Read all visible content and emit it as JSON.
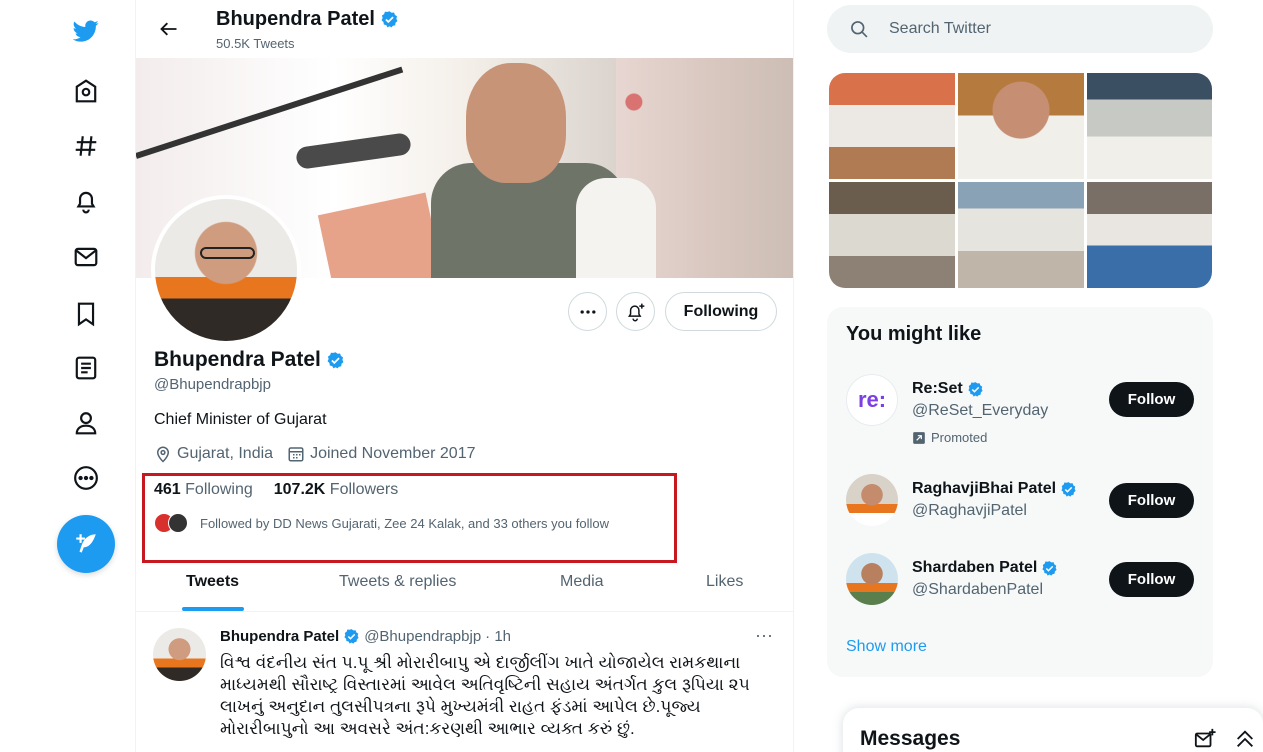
{
  "nav": {
    "items": [
      {
        "name": "twitter-logo-icon"
      },
      {
        "name": "home-icon"
      },
      {
        "name": "explore-hashtag-icon"
      },
      {
        "name": "notifications-bell-icon"
      },
      {
        "name": "messages-envelope-icon"
      },
      {
        "name": "bookmarks-icon"
      },
      {
        "name": "lists-icon"
      },
      {
        "name": "profile-icon"
      },
      {
        "name": "more-icon"
      }
    ],
    "brand_color": "#1d9bf0"
  },
  "header": {
    "name": "Bhupendra Patel",
    "tweet_count": "50.5K Tweets"
  },
  "profile": {
    "name": "Bhupendra Patel",
    "handle": "@Bhupendrapbjp",
    "bio": "Chief Minister of Gujarat",
    "location": "Gujarat, India",
    "joined": "Joined November 2017",
    "following_count": "461",
    "following_label": "Following",
    "followers_count": "107.2K",
    "followers_label": "Followers",
    "followed_by": "Followed by DD News Gujarati, Zee 24 Kalak, and 33 others you follow",
    "following_button": "Following",
    "highlight_color": "#c8181f"
  },
  "tabs": [
    "Tweets",
    "Tweets & replies",
    "Media",
    "Likes"
  ],
  "tweet": {
    "name": "Bhupendra Patel",
    "handle": "@Bhupendrapbjp",
    "time": "· 1h",
    "more": "···",
    "text": "વિશ્વ વંદનીય સંત પ.પૂ શ્રી મોરારીબાપુ એ દાર્જીલીંગ ખાતે યોજાયેલ રામકથાના માધ્યમથી સૌરાષ્ટ્ર વિસ્તારમાં આવેલ અતિવૃષ્ટિની સહાય અંતર્ગત કુલ રૂપિયા ૨૫ લાખનું અનુદાન તુલસીપત્રના રૂપે મુખ્યમંત્રી રાહત ફંડમાં આપેલ છે.પૂજ્ય મોરારીબાપુનો આ અવસરે અંત:કરણથી આભાર વ્યક્ત કરું છું."
  },
  "search": {
    "placeholder": "Search Twitter"
  },
  "you_might_like": {
    "title": "You might like",
    "items": [
      {
        "name": "Re:Set",
        "handle": "@ReSet_Everyday",
        "promoted": "Promoted",
        "button": "Follow"
      },
      {
        "name": "RaghavjiBhai Patel",
        "handle": "@RaghavjiPatel",
        "button": "Follow"
      },
      {
        "name": "Shardaben Patel",
        "handle": "@ShardabenPatel",
        "button": "Follow"
      }
    ],
    "show_more": "Show more"
  },
  "messages": {
    "title": "Messages"
  }
}
